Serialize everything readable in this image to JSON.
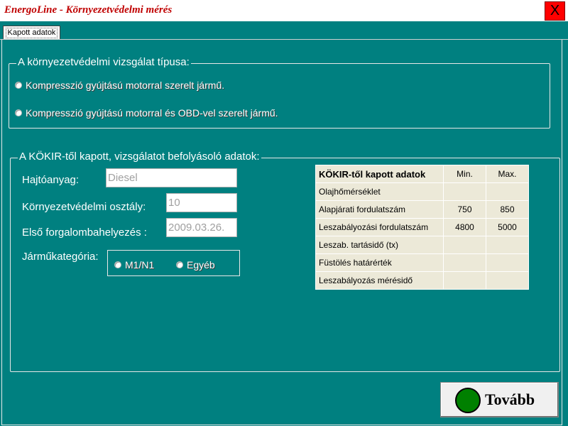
{
  "window": {
    "title": "EnergoLine  -  Környezetvédelmi mérés",
    "close_label": "X"
  },
  "tabs": [
    {
      "label": "Kapott adatok",
      "active": true
    }
  ],
  "test_type": {
    "title": "A környezetvédelmi vizsgálat típusa:",
    "options": [
      {
        "label": "Kompresszió gyújtású motorral szerelt jármű."
      },
      {
        "label": "Kompresszió gyújtású motorral és OBD-vel szerelt jármű."
      }
    ]
  },
  "kokir": {
    "title": "A KÖKIR-től kapott, vizsgálatot befolyásoló adatok:",
    "fuel": {
      "label": "Hajtóanyag:",
      "value": "Diesel"
    },
    "env_class": {
      "label": "Környezetvédelmi osztály:",
      "value": "10"
    },
    "first_reg": {
      "label": "Első forgalombahelyezés :",
      "value": "2009.03.26."
    },
    "category": {
      "label": "Járműkategória:",
      "options": [
        "M1/N1",
        "Egyéb"
      ]
    },
    "table": {
      "header": [
        "KÖKIR-től kapott adatok",
        "Min.",
        "Max."
      ],
      "rows": [
        [
          "Olajhőmérséklet",
          "",
          ""
        ],
        [
          "Alapjárati fordulatszám",
          "750",
          "850"
        ],
        [
          "Leszabályozási fordulatszám",
          "4800",
          "5000"
        ],
        [
          "Leszab. tartásidő (tx)",
          "",
          ""
        ],
        [
          "Füstölés határérték",
          "",
          ""
        ],
        [
          "Leszabályozás mérésidő",
          "",
          ""
        ]
      ]
    }
  },
  "next_button": {
    "label": "Tovább",
    "indicator_color": "#008000"
  },
  "colors": {
    "background": "#008080",
    "title": "#c00000",
    "close": "#ff0000"
  }
}
